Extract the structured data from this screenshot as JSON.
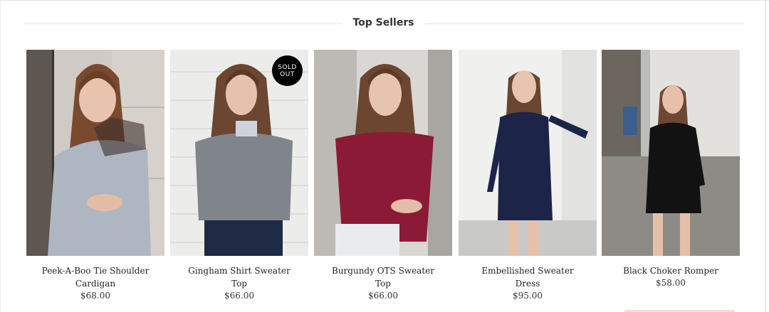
{
  "section": {
    "title": "Top Sellers"
  },
  "products": [
    {
      "name": "Peek-A-Boo Tie Shoulder Cardigan",
      "price": "$68.00",
      "image_icon": "product-photo",
      "badge": ""
    },
    {
      "name": "Gingham Shirt Sweater Top",
      "price": "$66.00",
      "image_icon": "product-photo",
      "badge": "SOLD OUT"
    },
    {
      "name": "Burgundy OTS Sweater Top",
      "price": "$66.00",
      "image_icon": "product-photo",
      "badge": ""
    },
    {
      "name": "Embellished Sweater Dress",
      "price": "$95.00",
      "image_icon": "product-photo",
      "badge": ""
    },
    {
      "name": "Black Choker Romper",
      "price": "$58.00",
      "image_icon": "product-photo",
      "badge": ""
    }
  ],
  "colors": {
    "badge_bg": "#000000",
    "badge_text": "#ffffff",
    "divider": "#e4e4e4",
    "heading_text": "#333333"
  }
}
